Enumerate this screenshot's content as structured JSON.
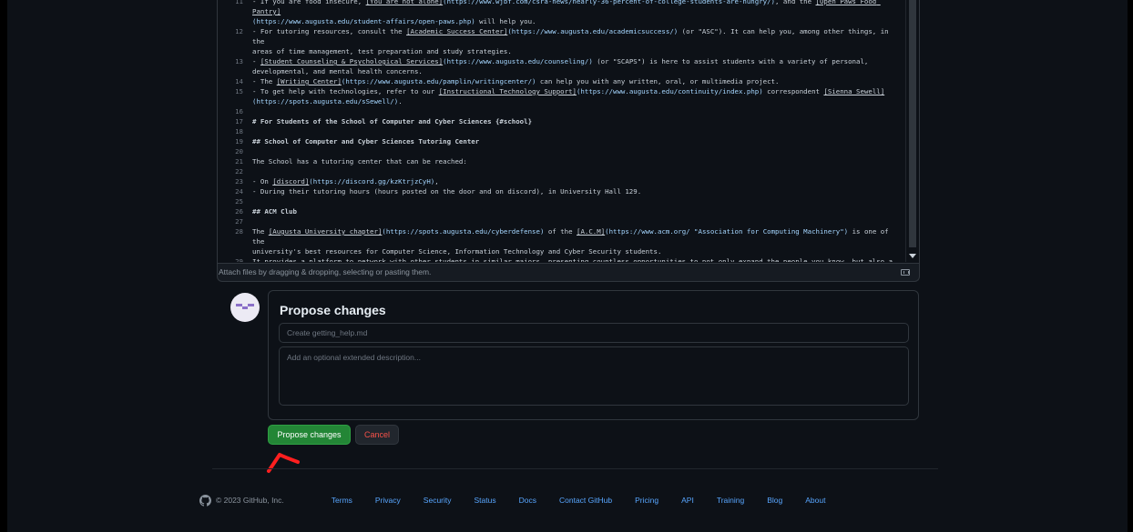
{
  "editor": {
    "lines": [
      {
        "n": "11",
        "html_parts": [
          {
            "t": "- If you are food insecure, "
          },
          {
            "t": "[You are not alone]",
            "c": "link"
          },
          {
            "t": "(https://www.wjbf.com/csra-news/nearly-36-percent-of-college-students-are-hungry/)",
            "c": "url"
          },
          {
            "t": ", and the "
          },
          {
            "t": "[Open Paws Food Pantry]",
            "c": "link"
          }
        ]
      },
      {
        "n": "",
        "html_parts": [
          {
            "t": "(https://www.augusta.edu/student-affairs/open-paws.php)",
            "c": "url"
          },
          {
            "t": " will help you."
          }
        ]
      },
      {
        "n": "12",
        "html_parts": [
          {
            "t": "- For tutoring resources, consult the "
          },
          {
            "t": "[Academic Success Center]",
            "c": "link"
          },
          {
            "t": "(https://www.augusta.edu/academicsuccess/)",
            "c": "url"
          },
          {
            "t": " (or \"ASC\"). It can help you, among other things, in the"
          }
        ]
      },
      {
        "n": "",
        "html_parts": [
          {
            "t": "areas of time management, test preparation and study strategies."
          }
        ]
      },
      {
        "n": "13",
        "html_parts": [
          {
            "t": "- "
          },
          {
            "t": "[Student Counseling & Psychological Services]",
            "c": "link"
          },
          {
            "t": "(https://www.augusta.edu/counseling/)",
            "c": "url"
          },
          {
            "t": " (or \"SCAPS\") is here to assist students with a variety of personal,"
          }
        ]
      },
      {
        "n": "",
        "html_parts": [
          {
            "t": "developmental, and mental health concerns."
          }
        ]
      },
      {
        "n": "14",
        "html_parts": [
          {
            "t": "- The "
          },
          {
            "t": "[Writing Center]",
            "c": "link"
          },
          {
            "t": "(https://www.augusta.edu/pamplin/writingcenter/)",
            "c": "url"
          },
          {
            "t": " can help you with any written, oral, or multimedia project."
          }
        ]
      },
      {
        "n": "15",
        "html_parts": [
          {
            "t": "- To get help with technologies, refer to our "
          },
          {
            "t": "[Instructional Technology Support]",
            "c": "link"
          },
          {
            "t": "(https://www.augusta.edu/continuity/index.php)",
            "c": "url"
          },
          {
            "t": " correspondent "
          },
          {
            "t": "[Sienna Sewell]",
            "c": "link"
          }
        ]
      },
      {
        "n": "",
        "html_parts": [
          {
            "t": "(https://spots.augusta.edu/sSewell/)",
            "c": "url"
          },
          {
            "t": "."
          }
        ]
      },
      {
        "n": "16",
        "html_parts": [
          {
            "t": ""
          }
        ]
      },
      {
        "n": "17",
        "html_parts": [
          {
            "t": "# For Students of the School of Computer and Cyber Sciences {#school}",
            "c": "hd"
          }
        ]
      },
      {
        "n": "18",
        "html_parts": [
          {
            "t": ""
          }
        ]
      },
      {
        "n": "19",
        "html_parts": [
          {
            "t": "## School of Computer and Cyber Sciences Tutoring Center",
            "c": "hd"
          }
        ]
      },
      {
        "n": "20",
        "html_parts": [
          {
            "t": ""
          }
        ]
      },
      {
        "n": "21",
        "html_parts": [
          {
            "t": "The School has a tutoring center that can be reached:"
          }
        ]
      },
      {
        "n": "22",
        "html_parts": [
          {
            "t": ""
          }
        ]
      },
      {
        "n": "23",
        "html_parts": [
          {
            "t": "- On "
          },
          {
            "t": "[discord]",
            "c": "link"
          },
          {
            "t": "(https://discord.gg/kzKtrjzCyH)",
            "c": "url"
          },
          {
            "t": ","
          }
        ]
      },
      {
        "n": "24",
        "html_parts": [
          {
            "t": "- During their tutoring hours (hours posted on the door and on discord), in University Hall 129."
          }
        ]
      },
      {
        "n": "25",
        "html_parts": [
          {
            "t": ""
          }
        ]
      },
      {
        "n": "26",
        "html_parts": [
          {
            "t": "## ACM Club",
            "c": "hd"
          }
        ]
      },
      {
        "n": "27",
        "html_parts": [
          {
            "t": ""
          }
        ]
      },
      {
        "n": "28",
        "html_parts": [
          {
            "t": "The "
          },
          {
            "t": "[Augusta University chapter]",
            "c": "link"
          },
          {
            "t": "(https://spots.augusta.edu/cyberdefense)",
            "c": "url"
          },
          {
            "t": " of the "
          },
          {
            "t": "[A.C.M]",
            "c": "link"
          },
          {
            "t": "(https://www.acm.org/ \"Association for Computing Machinery\")",
            "c": "url"
          },
          {
            "t": " is one of the"
          }
        ]
      },
      {
        "n": "",
        "html_parts": [
          {
            "t": "university's best resources for Computer Science, Information Technology and Cyber Security students."
          }
        ]
      },
      {
        "n": "29",
        "html_parts": [
          {
            "t": "It provides a platform to network with other students in similar majors, presenting countless opportunities to not only expand the people you know, but also a"
          }
        ]
      }
    ],
    "attach_hint": "Attach files by dragging & dropping, selecting or pasting them.",
    "markdown_icon": "markdown-icon"
  },
  "propose": {
    "title": "Propose changes",
    "commit_placeholder": "Create getting_help.md",
    "description_placeholder": "Add an optional extended description...",
    "submit_label": "Propose changes",
    "cancel_label": "Cancel"
  },
  "footer": {
    "copyright": "© 2023 GitHub, Inc.",
    "links": [
      "Terms",
      "Privacy",
      "Security",
      "Status",
      "Docs",
      "Contact GitHub",
      "Pricing",
      "API",
      "Training",
      "Blog",
      "About"
    ]
  },
  "colors": {
    "background": "#0d1117",
    "primary_button": "#238636",
    "danger_text": "#f85149",
    "link": "#58a6ff",
    "annotation": "#ff1f1f"
  }
}
